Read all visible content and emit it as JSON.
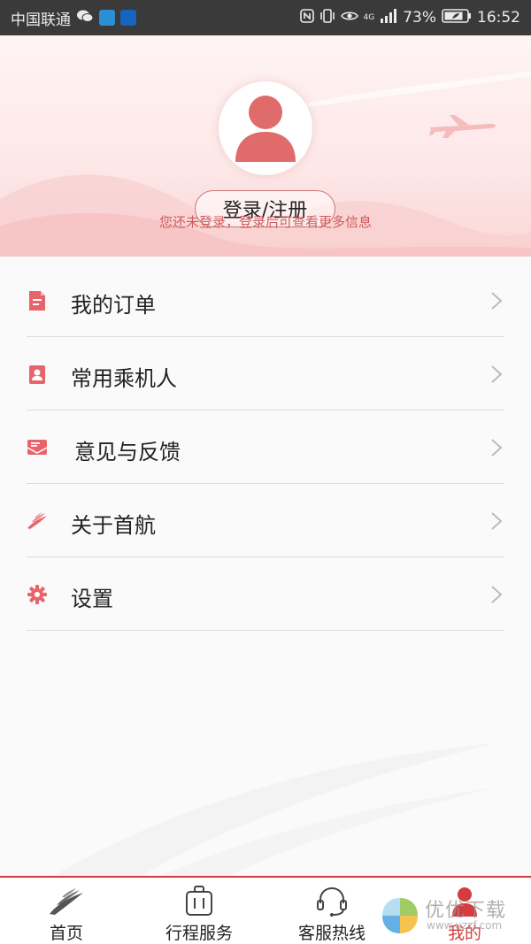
{
  "status_bar": {
    "carrier": "中国联通",
    "battery": "73%",
    "time": "16:52",
    "network": "4G"
  },
  "profile": {
    "login_label": "登录/注册",
    "hint": "您还未登录，登录后可查看更多信息"
  },
  "menu": {
    "items": [
      {
        "label": "我的订单",
        "icon": "order-icon"
      },
      {
        "label": "常用乘机人",
        "icon": "passenger-icon"
      },
      {
        "label": "意见与反馈",
        "icon": "feedback-icon"
      },
      {
        "label": "关于首航",
        "icon": "airline-logo-icon"
      },
      {
        "label": "设置",
        "icon": "settings-icon"
      }
    ]
  },
  "tabbar": {
    "tabs": [
      {
        "label": "首页",
        "icon": "home-logo-icon"
      },
      {
        "label": "行程服务",
        "icon": "luggage-icon"
      },
      {
        "label": "客服热线",
        "icon": "headset-icon"
      },
      {
        "label": "我的",
        "icon": "user-icon",
        "active": true
      }
    ]
  },
  "watermark": {
    "text": "优优下载",
    "url": "www.uzzf.com"
  },
  "colors": {
    "accent": "#d43d3d",
    "icon_red": "#e8646a",
    "status_bar": "#3a3a3a"
  }
}
